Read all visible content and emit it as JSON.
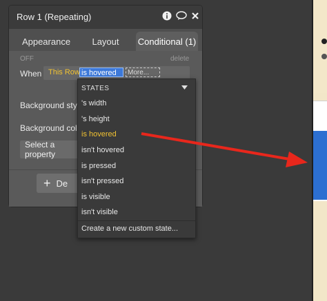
{
  "panel": {
    "title": "Row 1 (Repeating)",
    "tabs": [
      "Appearance",
      "Layout",
      "Conditional (1)"
    ],
    "active_tab": "Conditional (1)"
  },
  "conditional": {
    "off_label": "OFF",
    "delete_label": "delete",
    "when_label": "When",
    "this_row": "This Row",
    "condition": "is hovered",
    "more": "More...",
    "bg_style_label": "Background style",
    "bg_color_label": "Background color",
    "select_property": "Select a property",
    "define_button": "De"
  },
  "dropdown": {
    "header": "STATES",
    "items": [
      "'s width",
      "'s height",
      "is hovered",
      "isn't hovered",
      "is pressed",
      "isn't pressed",
      "is visible",
      "isn't visible"
    ],
    "selected": "is hovered",
    "footer": "Create a new custom state..."
  },
  "colors": {
    "arrow": "#e8271c",
    "selected_item": "#f1c232",
    "this_row": "#f1c232",
    "highlight": "#3d79d9"
  },
  "icons": [
    "info-icon",
    "chat-icon",
    "close-icon",
    "plus-icon",
    "caret-down-icon"
  ]
}
